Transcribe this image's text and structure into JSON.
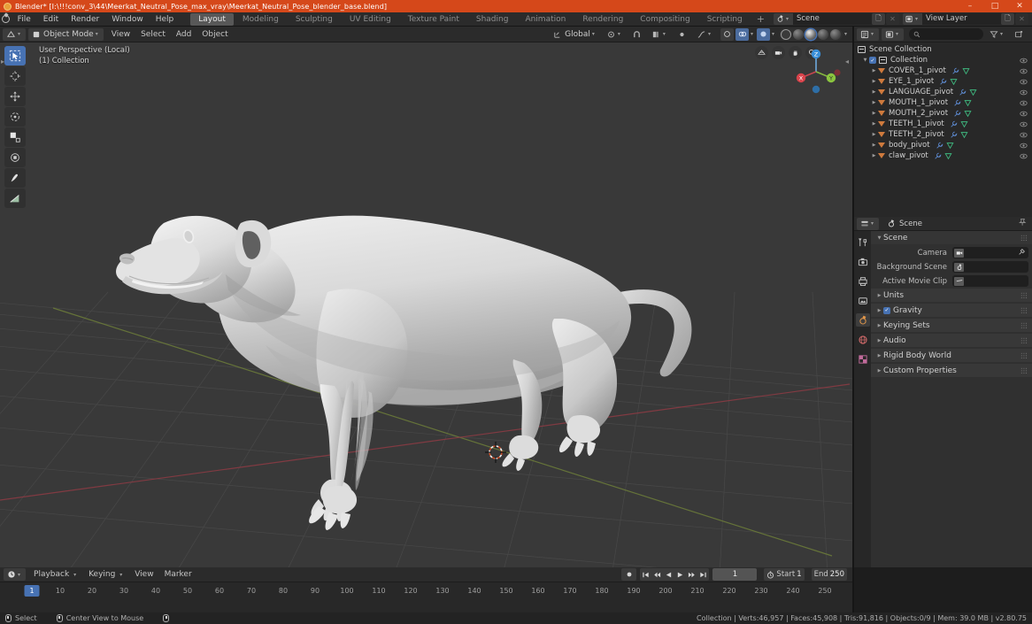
{
  "titlebar": {
    "title": "Blender* [I:\\!!!conv_3\\44\\Meerkat_Neutral_Pose_max_vray\\Meerkat_Neutral_Pose_blender_base.blend]",
    "color": "#d5481a",
    "minimize": "–",
    "maximize": "□",
    "close": "✕"
  },
  "menubar": {
    "logo_icon": "blender-logo-icon",
    "items": [
      "File",
      "Edit",
      "Render",
      "Window",
      "Help"
    ],
    "workspace_tabs": [
      {
        "label": "Layout",
        "active": true
      },
      {
        "label": "Modeling",
        "active": false
      },
      {
        "label": "Sculpting",
        "active": false
      },
      {
        "label": "UV Editing",
        "active": false
      },
      {
        "label": "Texture Paint",
        "active": false
      },
      {
        "label": "Shading",
        "active": false
      },
      {
        "label": "Animation",
        "active": false
      },
      {
        "label": "Rendering",
        "active": false
      },
      {
        "label": "Compositing",
        "active": false
      },
      {
        "label": "Scripting",
        "active": false
      }
    ],
    "add_workspace": "+",
    "scene_label": "Scene",
    "viewlayer_label": "View Layer"
  },
  "viewport": {
    "header": {
      "mode": "Object Mode",
      "menus": [
        "View",
        "Select",
        "Add",
        "Object"
      ],
      "transform_orientation": "Global",
      "snap_icon": "magnet-icon",
      "proportional_icon": "proportional-edit-icon"
    },
    "info_line1": "User Perspective (Local)",
    "info_line2": "(1) Collection",
    "tools": [
      {
        "name": "select-box-tool",
        "active": true
      },
      {
        "name": "cursor-tool",
        "active": false
      },
      {
        "name": "move-tool",
        "active": false
      },
      {
        "name": "rotate-tool",
        "active": false
      },
      {
        "name": "scale-tool",
        "active": false
      },
      {
        "name": "transform-tool",
        "active": false
      },
      {
        "name": "annotate-tool",
        "active": false
      },
      {
        "name": "measure-tool",
        "active": false
      }
    ],
    "nav_buttons": [
      "grid-snap-icon",
      "camera-icon",
      "hand-pan-icon",
      "zoom-magnifier-icon"
    ],
    "gizmo_axes": {
      "x": "X",
      "y": "Y",
      "z": "Z",
      "x_color": "#d9434b",
      "y_color": "#8bc53f",
      "z_color": "#3a8fd9"
    },
    "background_color": "#393939",
    "model_color": "#d6d6d6"
  },
  "outliner": {
    "display_mode_icon": "editor-type-icon",
    "filter_icon": "filter-icon",
    "search_placeholder": "",
    "new_collection_icon": "new-collection-icon",
    "scene_collection": "Scene Collection",
    "collection": "Collection",
    "items": [
      {
        "label": "COVER_1_pivot"
      },
      {
        "label": "EYE_1_pivot"
      },
      {
        "label": "LANGUAGE_pivot"
      },
      {
        "label": "MOUTH_1_pivot"
      },
      {
        "label": "MOUTH_2_pivot"
      },
      {
        "label": "TEETH_1_pivot"
      },
      {
        "label": "TEETH_2_pivot"
      },
      {
        "label": "body_pivot"
      },
      {
        "label": "claw_pivot"
      }
    ]
  },
  "properties": {
    "editor_icon": "properties-editor-icon",
    "breadcrumb": "Scene",
    "pin_icon": "pin-icon",
    "tabs": [
      {
        "name": "tool-tab",
        "active": false
      },
      {
        "name": "render-tab",
        "active": false
      },
      {
        "name": "output-tab",
        "active": false
      },
      {
        "name": "view-layer-tab",
        "active": false
      },
      {
        "name": "scene-tab",
        "active": true
      },
      {
        "name": "world-tab",
        "active": false
      },
      {
        "name": "texture-tab",
        "active": false
      }
    ],
    "scene_panel_title": "Scene",
    "fields": [
      {
        "label": "Camera",
        "icon": "camera-icon",
        "value": "",
        "eyedropper": true
      },
      {
        "label": "Background Scene",
        "icon": "scene-icon",
        "value": "",
        "eyedropper": false
      },
      {
        "label": "Active Movie Clip",
        "icon": "clip-icon",
        "value": "",
        "eyedropper": false
      }
    ],
    "panels": [
      {
        "label": "Units",
        "checkbox": false
      },
      {
        "label": "Gravity",
        "checkbox": true
      },
      {
        "label": "Keying Sets",
        "checkbox": false
      },
      {
        "label": "Audio",
        "checkbox": false
      },
      {
        "label": "Rigid Body World",
        "checkbox": false
      },
      {
        "label": "Custom Properties",
        "checkbox": false
      }
    ]
  },
  "timeline": {
    "editor_icon": "timeline-editor-icon",
    "menus": [
      "Playback",
      "Keying",
      "View",
      "Marker"
    ],
    "record_icon": "auto-keying-icon",
    "playback_buttons": [
      "jump-to-start-icon",
      "prev-keyframe-icon",
      "play-reverse-icon",
      "play-icon",
      "next-keyframe-icon",
      "jump-to-end-icon"
    ],
    "current_frame": "1",
    "use_preview_icon": "stopwatch-icon",
    "start_label": "Start",
    "start_value": "1",
    "end_label": "End",
    "end_value": "250",
    "ticks": [
      10,
      20,
      30,
      40,
      50,
      60,
      70,
      80,
      90,
      100,
      110,
      120,
      130,
      140,
      150,
      160,
      170,
      180,
      190,
      200,
      210,
      220,
      230,
      240,
      250
    ],
    "playhead_frame": "1"
  },
  "statusbar": {
    "hint1": "Select",
    "hint2": "Center View to Mouse",
    "stats": "Collection | Verts:46,957 | Faces:45,908 | Tris:91,816 | Objects:0/9 | Mem: 39.0 MB | v2.80.75"
  }
}
